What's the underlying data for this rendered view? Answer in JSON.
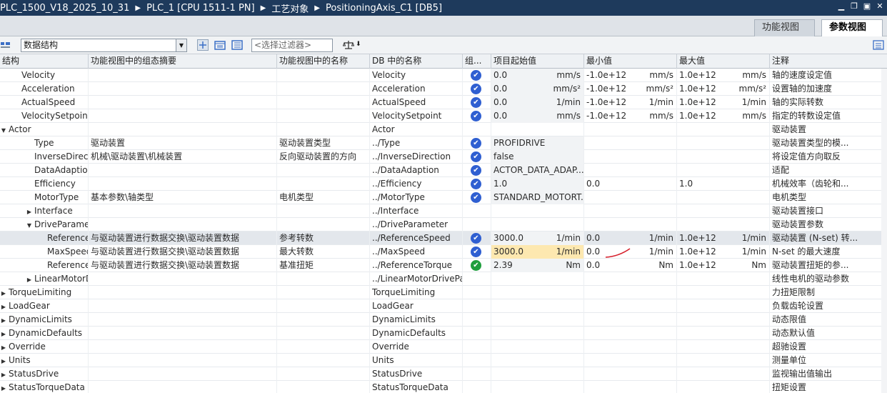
{
  "titlebar": {
    "crumbs": [
      "PLC_1500_V18_2025_10_31",
      "PLC_1 [CPU 1511-1 PN]",
      "工艺对象",
      "PositioningAxis_C1 [DB5]"
    ],
    "separator": "▶"
  },
  "view_tabs": [
    {
      "label": "功能视图",
      "active": false
    },
    {
      "label": "参数视图",
      "active": true
    }
  ],
  "toolbar": {
    "structure_select": "数据结构",
    "filter_placeholder": "<选择过滤器>"
  },
  "columns": [
    "结构",
    "功能视图中的组态摘要",
    "功能视图中的名称",
    "DB 中的名称",
    "组...",
    "项目起始值",
    "最小值",
    "最大值",
    "注释"
  ],
  "rows": [
    {
      "indent": 1,
      "expander": "",
      "name": "Velocity",
      "summary": "",
      "fname": "",
      "db": "Velocity",
      "check": "blue",
      "start": "0.0",
      "start_unit": "mm/s",
      "min": "-1.0e+12",
      "min_unit": "mm/s",
      "max": "1.0e+12",
      "max_unit": "mm/s",
      "comment": "轴的速度设定值"
    },
    {
      "indent": 1,
      "expander": "",
      "name": "Acceleration",
      "summary": "",
      "fname": "",
      "db": "Acceleration",
      "check": "blue",
      "start": "0.0",
      "start_unit": "mm/s²",
      "min": "-1.0e+12",
      "min_unit": "mm/s²",
      "max": "1.0e+12",
      "max_unit": "mm/s²",
      "comment": "设置轴的加速度"
    },
    {
      "indent": 1,
      "expander": "",
      "name": "ActualSpeed",
      "summary": "",
      "fname": "",
      "db": "ActualSpeed",
      "check": "blue",
      "start": "0.0",
      "start_unit": "1/min",
      "min": "-1.0e+12",
      "min_unit": "1/min",
      "max": "1.0e+12",
      "max_unit": "1/min",
      "comment": "轴的实际转数"
    },
    {
      "indent": 1,
      "expander": "",
      "name": "VelocitySetpoint",
      "summary": "",
      "fname": "",
      "db": "VelocitySetpoint",
      "check": "blue",
      "start": "0.0",
      "start_unit": "mm/s",
      "min": "-1.0e+12",
      "min_unit": "mm/s",
      "max": "1.0e+12",
      "max_unit": "mm/s",
      "comment": "指定的转数设定值"
    },
    {
      "indent": 0,
      "expander": "▼",
      "name": "Actor",
      "summary": "",
      "fname": "",
      "db": "Actor",
      "check": "",
      "start": "",
      "start_unit": "",
      "min": "",
      "min_unit": "",
      "max": "",
      "max_unit": "",
      "comment": "驱动装置"
    },
    {
      "indent": 2,
      "expander": "",
      "name": "Type",
      "summary": "驱动装置",
      "fname": "驱动装置类型",
      "db": "../Type",
      "check": "blue",
      "start": "PROFIDRIVE",
      "start_unit": "",
      "min": "",
      "min_unit": "",
      "max": "",
      "max_unit": "",
      "comment": "驱动装置类型的模..."
    },
    {
      "indent": 2,
      "expander": "",
      "name": "InverseDirection",
      "summary": "机械\\驱动装置\\机械装置",
      "fname": "反向驱动装置的方向",
      "db": "../InverseDirection",
      "check": "blue",
      "start": "false",
      "start_unit": "",
      "min": "",
      "min_unit": "",
      "max": "",
      "max_unit": "",
      "comment": "将设定值方向取反"
    },
    {
      "indent": 2,
      "expander": "",
      "name": "DataAdaption",
      "summary": "",
      "fname": "",
      "db": "../DataAdaption",
      "check": "blue",
      "start": "ACTOR_DATA_ADAP...",
      "start_unit": "",
      "min": "",
      "min_unit": "",
      "max": "",
      "max_unit": "",
      "comment": "适配"
    },
    {
      "indent": 2,
      "expander": "",
      "name": "Efficiency",
      "summary": "",
      "fname": "",
      "db": "../Efficiency",
      "check": "blue",
      "start": "1.0",
      "start_unit": "",
      "min": "0.0",
      "min_unit": "",
      "max": "1.0",
      "max_unit": "",
      "comment": "机械效率（齿轮和..."
    },
    {
      "indent": 2,
      "expander": "",
      "name": "MotorType",
      "summary": "基本参数\\轴类型",
      "fname": "电机类型",
      "db": "../MotorType",
      "check": "blue",
      "start": "STANDARD_MOTORT...",
      "start_unit": "",
      "min": "",
      "min_unit": "",
      "max": "",
      "max_unit": "",
      "comment": "电机类型"
    },
    {
      "indent": 2,
      "expander": "▶",
      "name": "Interface",
      "summary": "",
      "fname": "",
      "db": "../Interface",
      "check": "",
      "start": "",
      "start_unit": "",
      "min": "",
      "min_unit": "",
      "max": "",
      "max_unit": "",
      "comment": "驱动装置接口"
    },
    {
      "indent": 2,
      "expander": "▼",
      "name": "DriveParameter",
      "summary": "",
      "fname": "",
      "db": "../DriveParameter",
      "check": "",
      "start": "",
      "start_unit": "",
      "min": "",
      "min_unit": "",
      "max": "",
      "max_unit": "",
      "comment": "驱动装置参数"
    },
    {
      "indent": 3,
      "expander": "",
      "name": "ReferenceS...",
      "summary": "与驱动装置进行数据交换\\驱动装置数据",
      "fname": "参考转数",
      "db": "../ReferenceSpeed",
      "check": "blue",
      "start": "3000.0",
      "start_unit": "1/min",
      "min": "0.0",
      "min_unit": "1/min",
      "max": "1.0e+12",
      "max_unit": "1/min",
      "comment": "驱动装置 (N-set) 转...",
      "selected": true
    },
    {
      "indent": 3,
      "expander": "",
      "name": "MaxSpeed",
      "summary": "与驱动装置进行数据交换\\驱动装置数据",
      "fname": "最大转数",
      "db": "../MaxSpeed",
      "check": "blue",
      "start": "3000.0",
      "start_unit": "1/min",
      "min": "0.0",
      "min_unit": "1/min",
      "max": "1.0e+12",
      "max_unit": "1/min",
      "comment": "N-set 的最大速度",
      "highlight": true
    },
    {
      "indent": 3,
      "expander": "",
      "name": "ReferenceT...",
      "summary": "与驱动装置进行数据交换\\驱动装置数据",
      "fname": "基准扭矩",
      "db": "../ReferenceTorque",
      "check": "green",
      "start": "2.39",
      "start_unit": "Nm",
      "min": "0.0",
      "min_unit": "Nm",
      "max": "1.0e+12",
      "max_unit": "Nm",
      "comment": "驱动装置扭矩的参..."
    },
    {
      "indent": 2,
      "expander": "▶",
      "name": "LinearMotorDr...",
      "summary": "",
      "fname": "",
      "db": "../LinearMotorDrivePa...",
      "check": "",
      "start": "",
      "start_unit": "",
      "min": "",
      "min_unit": "",
      "max": "",
      "max_unit": "",
      "comment": "线性电机的驱动参数"
    },
    {
      "indent": 0,
      "expander": "▶",
      "name": "TorqueLimiting",
      "summary": "",
      "fname": "",
      "db": "TorqueLimiting",
      "check": "",
      "start": "",
      "start_unit": "",
      "min": "",
      "min_unit": "",
      "max": "",
      "max_unit": "",
      "comment": "力扭矩限制"
    },
    {
      "indent": 0,
      "expander": "▶",
      "name": "LoadGear",
      "summary": "",
      "fname": "",
      "db": "LoadGear",
      "check": "",
      "start": "",
      "start_unit": "",
      "min": "",
      "min_unit": "",
      "max": "",
      "max_unit": "",
      "comment": "负载齿轮设置"
    },
    {
      "indent": 0,
      "expander": "▶",
      "name": "DynamicLimits",
      "summary": "",
      "fname": "",
      "db": "DynamicLimits",
      "check": "",
      "start": "",
      "start_unit": "",
      "min": "",
      "min_unit": "",
      "max": "",
      "max_unit": "",
      "comment": "动态限值"
    },
    {
      "indent": 0,
      "expander": "▶",
      "name": "DynamicDefaults",
      "summary": "",
      "fname": "",
      "db": "DynamicDefaults",
      "check": "",
      "start": "",
      "start_unit": "",
      "min": "",
      "min_unit": "",
      "max": "",
      "max_unit": "",
      "comment": "动态默认值"
    },
    {
      "indent": 0,
      "expander": "▶",
      "name": "Override",
      "summary": "",
      "fname": "",
      "db": "Override",
      "check": "",
      "start": "",
      "start_unit": "",
      "min": "",
      "min_unit": "",
      "max": "",
      "max_unit": "",
      "comment": "超驰设置"
    },
    {
      "indent": 0,
      "expander": "▶",
      "name": "Units",
      "summary": "",
      "fname": "",
      "db": "Units",
      "check": "",
      "start": "",
      "start_unit": "",
      "min": "",
      "min_unit": "",
      "max": "",
      "max_unit": "",
      "comment": "测量单位"
    },
    {
      "indent": 0,
      "expander": "▶",
      "name": "StatusDrive",
      "summary": "",
      "fname": "",
      "db": "StatusDrive",
      "check": "",
      "start": "",
      "start_unit": "",
      "min": "",
      "min_unit": "",
      "max": "",
      "max_unit": "",
      "comment": "监视输出值输出"
    },
    {
      "indent": 0,
      "expander": "▶",
      "name": "StatusTorqueData",
      "summary": "",
      "fname": "",
      "db": "StatusTorqueData",
      "check": "",
      "start": "",
      "start_unit": "",
      "min": "",
      "min_unit": "",
      "max": "",
      "max_unit": "",
      "comment": "扭矩设置"
    }
  ],
  "colors": {
    "accent_blue": "#2f5fd1",
    "ok_green": "#1f9e3d",
    "title_bg": "#1e3a5c",
    "highlight": "#fde8b0"
  }
}
